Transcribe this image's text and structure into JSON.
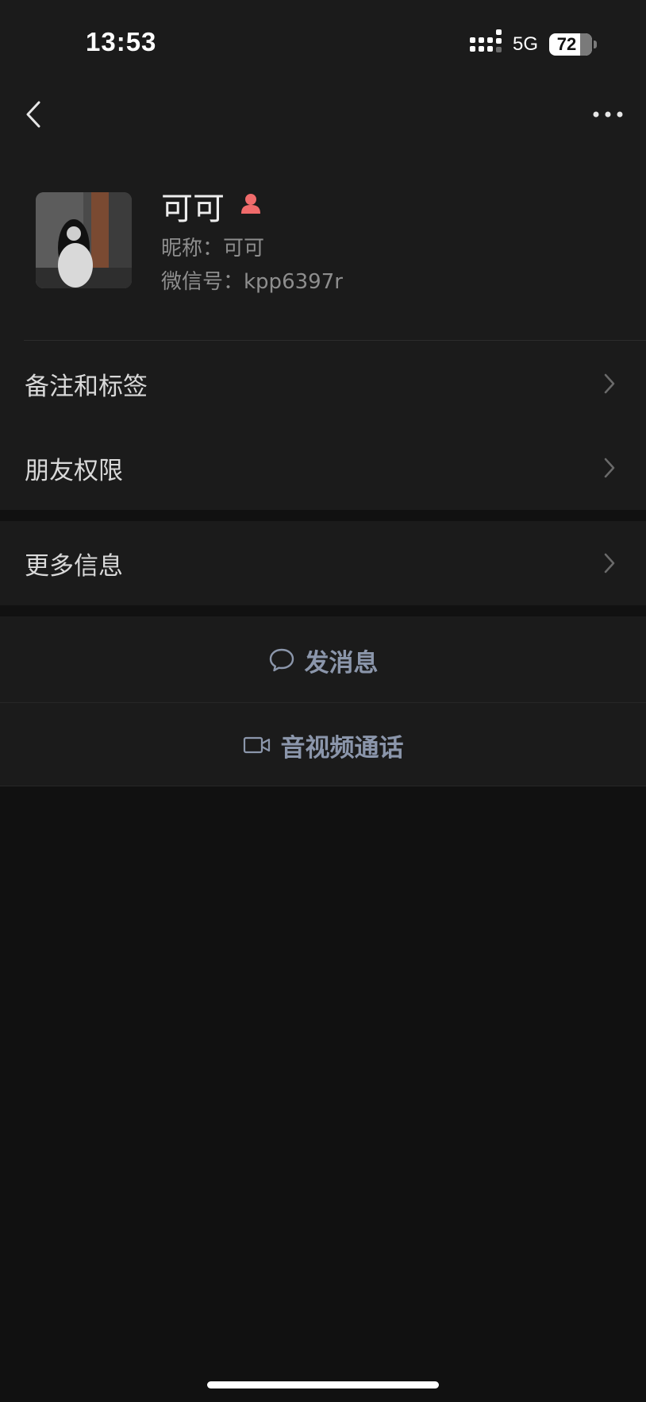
{
  "status_bar": {
    "time": "13:53",
    "network": "5G",
    "battery": "72",
    "battery_level_pct": 72
  },
  "nav": {
    "back_icon": "chevron-left-icon",
    "more_icon": "more-dots-icon"
  },
  "profile": {
    "name": "可可",
    "gender_icon": "female-icon",
    "gender_color": "#f06b6b",
    "nickname": "昵称：可可",
    "wechat_id": "微信号：kpp6397r"
  },
  "menu": {
    "items": [
      {
        "label": "备注和标签"
      },
      {
        "label": "朋友权限"
      },
      {
        "label": "更多信息"
      }
    ]
  },
  "actions": {
    "message": {
      "label": "发消息",
      "icon": "chat-bubble-icon"
    },
    "call": {
      "label": "音视频通话",
      "icon": "video-camera-icon"
    }
  },
  "colors": {
    "background": "#111111",
    "surface": "#1b1b1b",
    "action_text": "#8b96ab"
  }
}
